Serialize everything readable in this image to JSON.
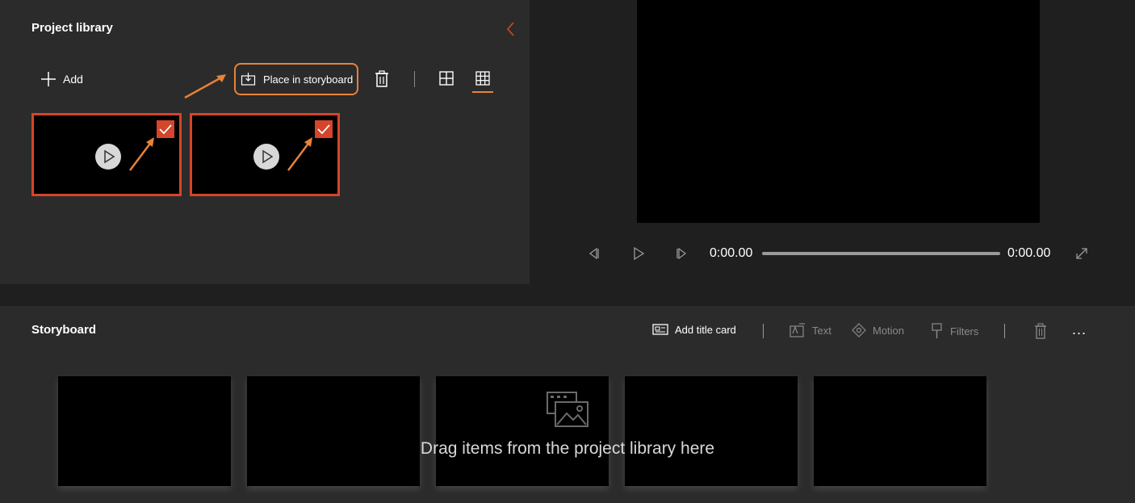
{
  "library": {
    "title": "Project library",
    "add_label": "Add",
    "place_label": "Place in storyboard"
  },
  "preview": {
    "time_current": "0:00.00",
    "time_total": "0:00.00"
  },
  "storyboard": {
    "title": "Storyboard",
    "add_title_card_label": "Add title card",
    "text_label": "Text",
    "motion_label": "Motion",
    "filters_label": "Filters",
    "more_label": "...",
    "drop_hint": "Drag items from the project library here"
  },
  "colors": {
    "accent": "#d4452a",
    "highlight": "#e8823a"
  }
}
